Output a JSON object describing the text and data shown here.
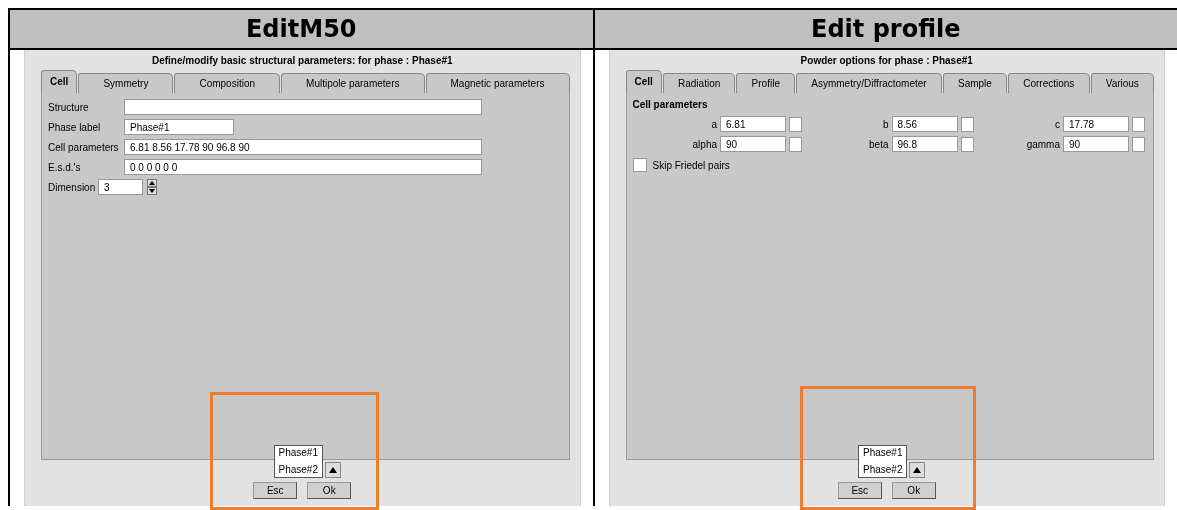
{
  "columns": [
    {
      "heading": "EditM50",
      "dialog": {
        "kind": "form",
        "title": "Define/modify basic structural parameters: for phase : Phase#1",
        "tabs": [
          {
            "label": "Cell",
            "selected": true
          },
          {
            "label": "Symmetry",
            "selected": false
          },
          {
            "label": "Composition",
            "selected": false
          },
          {
            "label": "Multipole parameters",
            "selected": false
          },
          {
            "label": "Magnetic parameters",
            "selected": false
          }
        ],
        "fields": [
          {
            "kind": "text",
            "label": "Structure"
          },
          {
            "kind": "short",
            "label": "Phase label",
            "value": "Phase#1"
          },
          {
            "kind": "text",
            "label": "Cell parameters",
            "value": "6.81 8.56 17.78 90 96.8 90"
          },
          {
            "kind": "text",
            "label": "E.s.d.'s",
            "value": "0 0 0 0 0 0"
          },
          {
            "kind": "spin",
            "label": "Dimension",
            "value": "3"
          }
        ],
        "phase_list": [
          "Phase#1",
          "Phase#2"
        ],
        "buttons": [
          "Esc",
          "Ok"
        ]
      }
    },
    {
      "heading": "Edit profile",
      "dialog": {
        "kind": "grid",
        "title": "Powder options for phase : Phase#1",
        "tabs": [
          {
            "label": "Cell",
            "selected": true
          },
          {
            "label": "Radiation",
            "selected": false
          },
          {
            "label": "Profile",
            "selected": false
          },
          {
            "label": "Asymmetry/Diffractometer",
            "selected": false
          },
          {
            "label": "Sample",
            "selected": false
          },
          {
            "label": "Corrections",
            "selected": false
          },
          {
            "label": "Various",
            "selected": false
          }
        ],
        "section": "Cell parameters",
        "cells": [
          {
            "label": "a",
            "value": "6.81",
            "checked": false
          },
          {
            "label": "b",
            "value": "8.56",
            "checked": false
          },
          {
            "label": "c",
            "value": "17.78",
            "checked": false
          },
          {
            "label": "alpha",
            "value": "90",
            "checked": false
          },
          {
            "label": "beta",
            "value": "96.8",
            "checked": false
          },
          {
            "label": "gamma",
            "value": "90",
            "checked": false
          }
        ],
        "checkboxes": [
          {
            "label": "Skip Friedel pairs",
            "checked": false
          }
        ],
        "phase_list": [
          "Phase#1",
          "Phase#2"
        ],
        "buttons": [
          "Esc",
          "Ok"
        ]
      }
    }
  ]
}
